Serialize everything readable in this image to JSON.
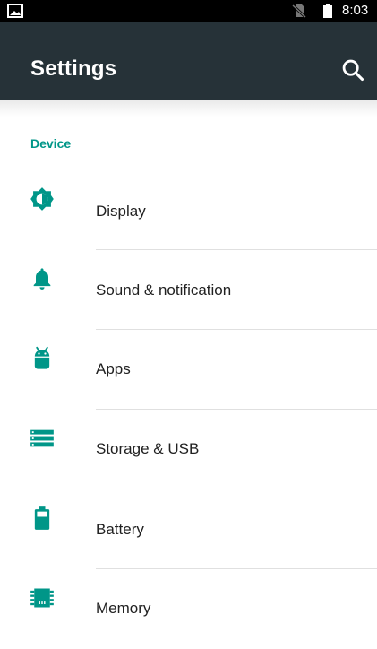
{
  "status_bar": {
    "time": "8:03",
    "icons": [
      "image-notification-icon",
      "no-sim-icon",
      "battery-icon"
    ]
  },
  "app_bar": {
    "title": "Settings",
    "search_icon": "search-icon",
    "background": "#263238"
  },
  "section": {
    "title": "Device",
    "accent_color": "#009688"
  },
  "items": [
    {
      "label": "Display",
      "icon": "display-brightness-icon"
    },
    {
      "label": "Sound & notification",
      "icon": "bell-icon"
    },
    {
      "label": "Apps",
      "icon": "android-icon"
    },
    {
      "label": "Storage & USB",
      "icon": "storage-icon"
    },
    {
      "label": "Battery",
      "icon": "battery-icon"
    },
    {
      "label": "Memory",
      "icon": "memory-chip-icon"
    }
  ]
}
